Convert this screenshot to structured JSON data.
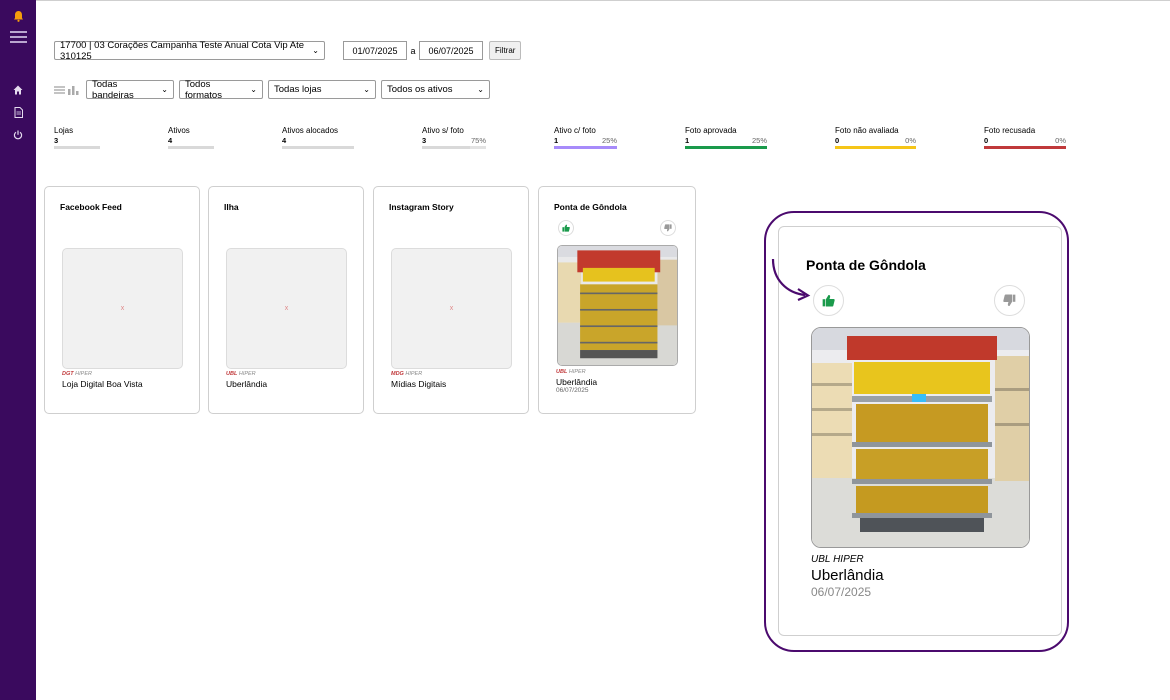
{
  "filters": {
    "campaign": "17700 | 03 Corações Campanha Teste Anual Cota Vip Ate 310125",
    "date_from": "01/07/2025",
    "date_sep": "a",
    "date_to": "06/07/2025",
    "filter_button": "Filtrar",
    "bandeiras": "Todas bandeiras",
    "formatos": "Todos formatos",
    "lojas": "Todas lojas",
    "ativos": "Todos os ativos"
  },
  "stats": [
    {
      "label": "Lojas",
      "value": "3",
      "pct": "",
      "color": "#d9d9d9",
      "fill": 0
    },
    {
      "label": "Ativos",
      "value": "4",
      "pct": "",
      "color": "#d9d9d9",
      "fill": 0
    },
    {
      "label": "Ativos alocados",
      "value": "4",
      "pct": "",
      "color": "#d9d9d9",
      "fill": 0
    },
    {
      "label": "Ativo s/ foto",
      "value": "3",
      "pct": "75%",
      "color": "#d9d9d9",
      "fill": 0.75
    },
    {
      "label": "Ativo c/ foto",
      "value": "1",
      "pct": "25%",
      "color": "#a78bfa",
      "fill": 1
    },
    {
      "label": "Foto aprovada",
      "value": "1",
      "pct": "25%",
      "color": "#1a9a4b",
      "fill": 1
    },
    {
      "label": "Foto não avaliada",
      "value": "0",
      "pct": "0%",
      "color": "#f5c518",
      "fill": 1
    },
    {
      "label": "Foto recusada",
      "value": "0",
      "pct": "0%",
      "color": "#c0393b",
      "fill": 1
    }
  ],
  "cards": [
    {
      "title": "Facebook Feed",
      "placeholder": "x",
      "code": "DGT",
      "type": "HIPER",
      "place": "Loja Digital Boa Vista",
      "date": ""
    },
    {
      "title": "Ilha",
      "placeholder": "x",
      "code": "UBL",
      "type": "HIPER",
      "place": "Uberlândia",
      "date": ""
    },
    {
      "title": "Instagram Story",
      "placeholder": "x",
      "code": "MDG",
      "type": "HIPER",
      "place": "Mídias Digitais",
      "date": ""
    },
    {
      "title": "Ponta de Gôndola",
      "placeholder": "",
      "code": "UBL",
      "type": "HIPER",
      "place": "Uberlândia",
      "date": "06/07/2025"
    }
  ],
  "detail": {
    "title": "Ponta de Gôndola",
    "code": "UBL",
    "type": "HIPER",
    "place": "Uberlândia",
    "date": "06/07/2025"
  },
  "colors": {
    "sidebar": "#3a0a5e",
    "approve": "#1a9a4b",
    "highlight": "#4b0a6e",
    "store_code": "#c0393b"
  }
}
